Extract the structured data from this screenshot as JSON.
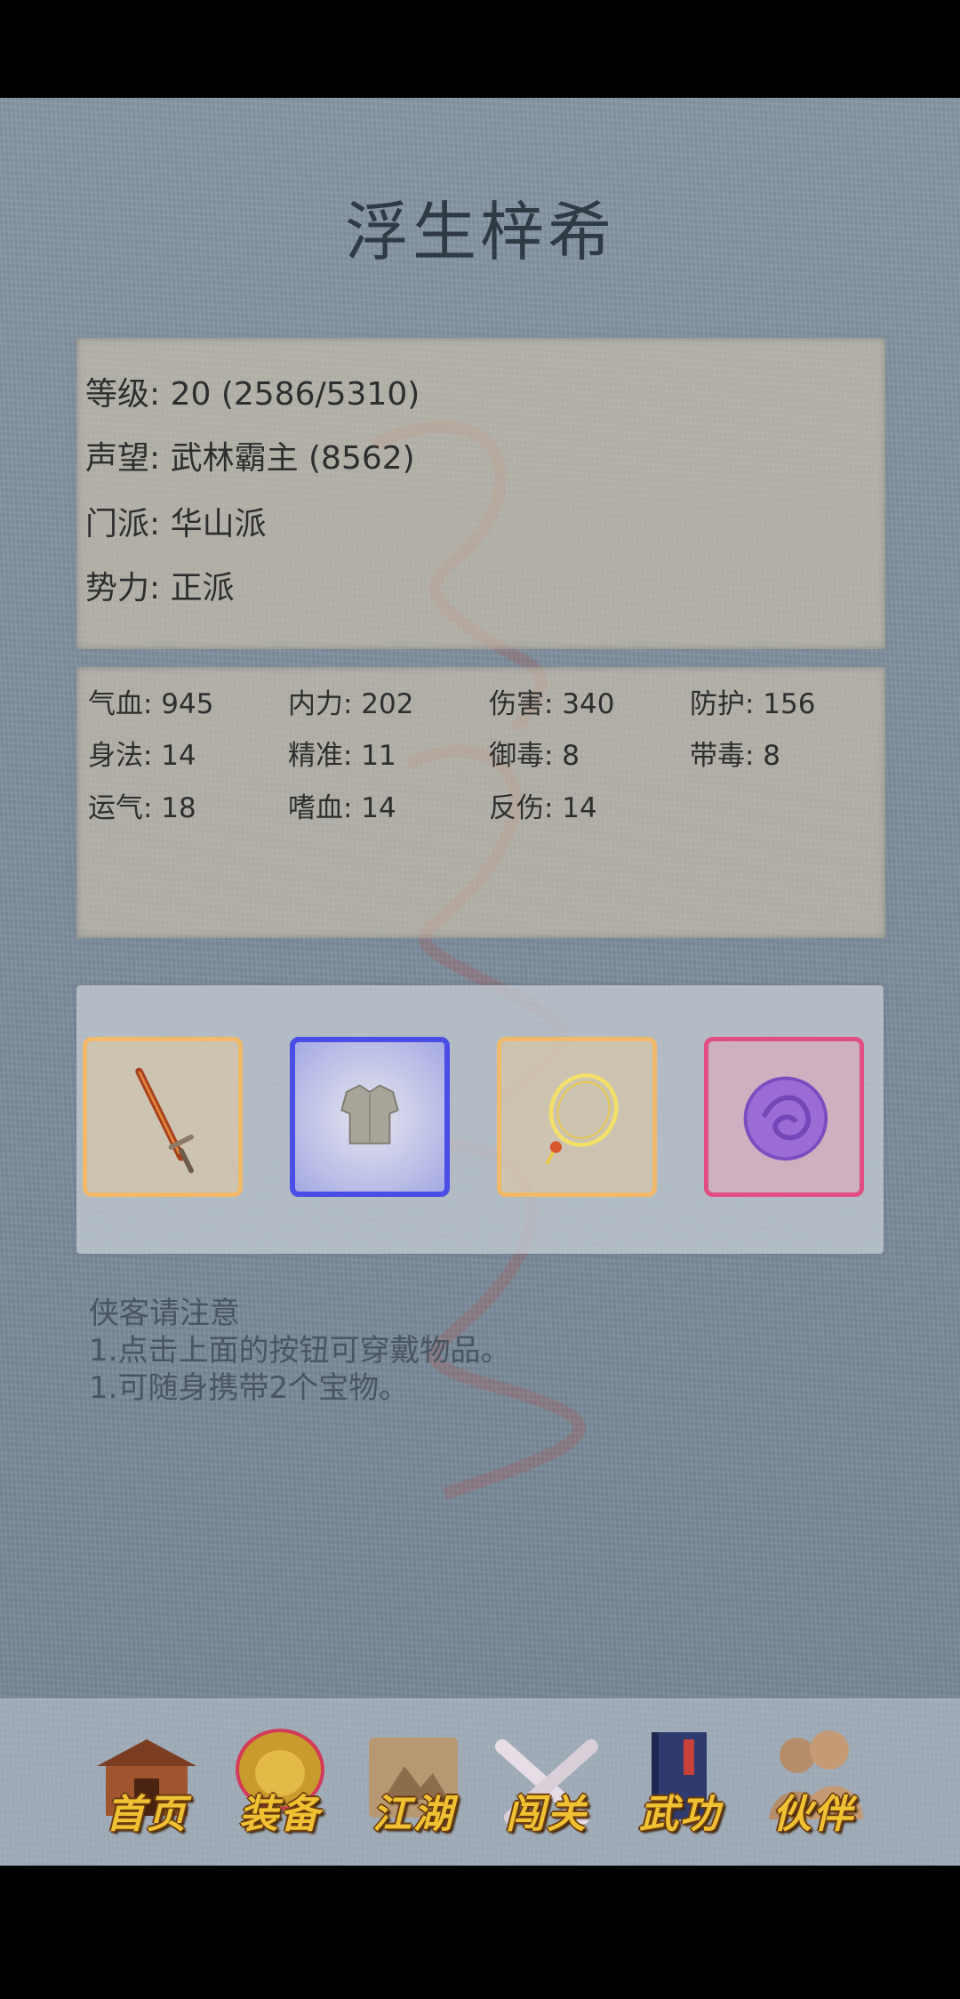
{
  "header": {
    "character_name": "浮生梓希"
  },
  "info": {
    "level": "等级: 20 (2586/5310)",
    "reputation": "声望: 武林霸主 (8562)",
    "sect": "门派: 华山派",
    "faction": "势力:  正派"
  },
  "stats": [
    {
      "label": "气血: 945"
    },
    {
      "label": "内力: 202"
    },
    {
      "label": "伤害: 340"
    },
    {
      "label": "防护: 156"
    },
    {
      "label": "身法: 14"
    },
    {
      "label": "精准: 11"
    },
    {
      "label": "御毒: 8"
    },
    {
      "label": "带毒: 8"
    },
    {
      "label": "运气: 18"
    },
    {
      "label": "嗜血: 14"
    },
    {
      "label": "反伤: 14"
    }
  ],
  "equipment": {
    "slots": [
      {
        "item_icon": "sword-icon",
        "rarity_color": "#f1b96a"
      },
      {
        "item_icon": "armor-icon",
        "rarity_color": "#4a4ee6"
      },
      {
        "item_icon": "necklace-icon",
        "rarity_color": "#f1b96a"
      },
      {
        "item_icon": "treasure-seal-icon",
        "rarity_color": "#e24d84"
      }
    ]
  },
  "notice": {
    "title": "侠客请注意",
    "line1": "1.点击上面的按钮可穿戴物品。",
    "line2": "1.可随身携带2个宝物。"
  },
  "bottom_nav": {
    "items": [
      {
        "label": "首页",
        "icon": "house-icon"
      },
      {
        "label": "装备",
        "icon": "armor-icon"
      },
      {
        "label": "江湖",
        "icon": "scroll-map-icon"
      },
      {
        "label": "闯关",
        "icon": "crossed-swords-icon"
      },
      {
        "label": "武功",
        "icon": "book-icon"
      },
      {
        "label": "伙伴",
        "icon": "partners-icon"
      }
    ]
  },
  "colors": {
    "accent_gold": "#f0c233",
    "title_text": "#2f3a45"
  }
}
